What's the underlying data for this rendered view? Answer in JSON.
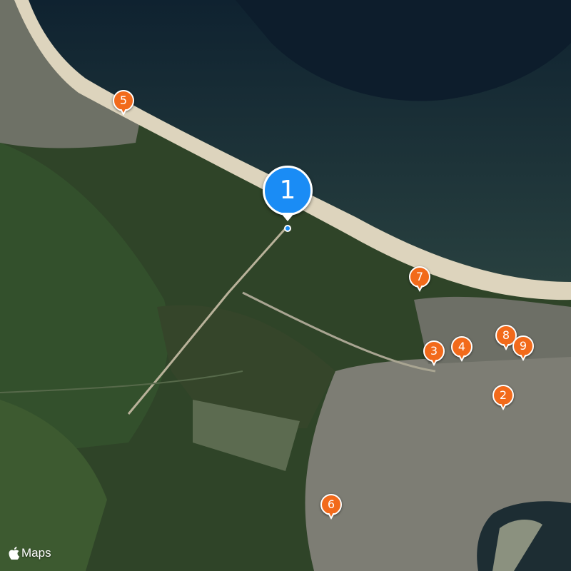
{
  "map": {
    "attribution": {
      "icon": "apple-logo-icon",
      "label": "Maps"
    },
    "colors": {
      "water_deep": "#0f2230",
      "water_shallow": "#243a3f",
      "beach": "#ddd4bd",
      "forest": "#2e4326",
      "urban": "#7e7e74",
      "primary_pin": "#1a8cf5",
      "secondary_pin": "#f26a1b"
    },
    "markers": [
      {
        "id": "marker-1",
        "label": "1",
        "kind": "primary"
      },
      {
        "id": "marker-2",
        "label": "2",
        "kind": "secondary"
      },
      {
        "id": "marker-3",
        "label": "3",
        "kind": "secondary"
      },
      {
        "id": "marker-4",
        "label": "4",
        "kind": "secondary"
      },
      {
        "id": "marker-5",
        "label": "5",
        "kind": "secondary"
      },
      {
        "id": "marker-6",
        "label": "6",
        "kind": "secondary"
      },
      {
        "id": "marker-7",
        "label": "7",
        "kind": "secondary"
      },
      {
        "id": "marker-8",
        "label": "8",
        "kind": "secondary"
      },
      {
        "id": "marker-9",
        "label": "9",
        "kind": "secondary"
      }
    ]
  }
}
